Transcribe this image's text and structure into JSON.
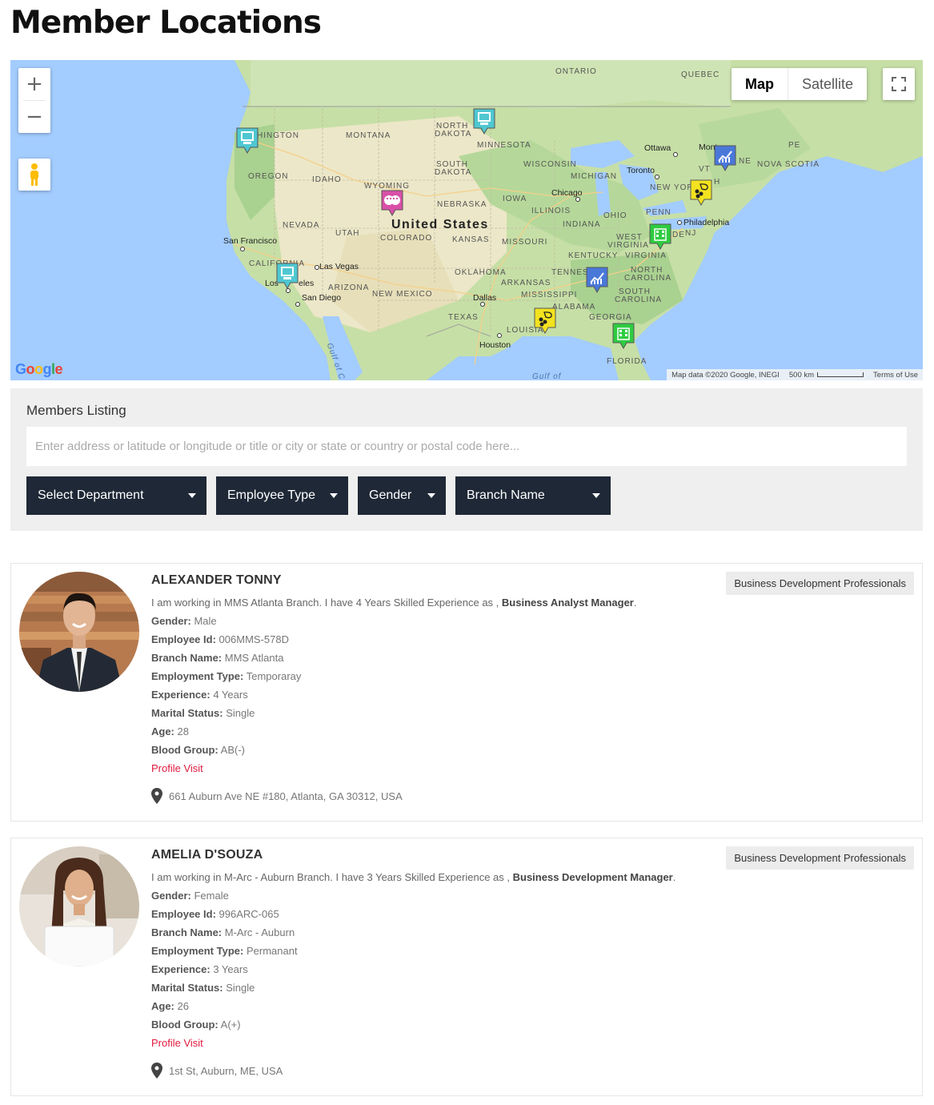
{
  "page_title": "Member Locations",
  "map": {
    "zoom_in": "+",
    "zoom_out": "−",
    "type_map": "Map",
    "type_satellite": "Satellite",
    "google": "Google",
    "attribution": "Map data ©2020 Google, INEGI",
    "scale": "500 km",
    "terms": "Terms of Use",
    "labels": {
      "ontario": "ONTARIO",
      "quebec": "QUEBEC",
      "washington": "HINGTON",
      "montana": "MONTANA",
      "north_dakota_1": "NORTH",
      "north_dakota_2": "DAKOTA",
      "minnesota": "MINNESOTA",
      "oregon": "OREGON",
      "idaho": "IDAHO",
      "south_dakota_1": "SOUTH",
      "south_dakota_2": "DAKOTA",
      "wyoming": "WYOMING",
      "wisconsin": "WISCONSIN",
      "michigan": "MICHIGAN",
      "nevada": "NEVADA",
      "utah": "UTAH",
      "colorado": "COLORADO",
      "nebraska": "NEBRASKA",
      "iowa": "IOWA",
      "illinois": "ILLINOIS",
      "indiana": "INDIANA",
      "ohio": "OHIO",
      "kansas": "KANSAS",
      "missouri": "MISSOURI",
      "california": "CALIFORNIA",
      "arizona": "ARIZONA",
      "new_mexico": "NEW MEXICO",
      "oklahoma": "OKLAHOMA",
      "arkansas": "ARKANSAS",
      "tennessee": "TENNES",
      "kentucky": "KENTUCKY",
      "texas": "TEXAS",
      "louisiana": "LOUISIA",
      "mississippi": "MISSISSIPPI",
      "alabama": "ALABAMA",
      "georgia": "GEORGIA",
      "florida": "FLORIDA",
      "south_carolina_1": "SOUTH",
      "south_carolina_2": "CAROLINA",
      "north_carolina_1": "NORTH",
      "north_carolina_2": "CAROLINA",
      "virginia": "VIRGINIA",
      "west_virginia_1": "WEST",
      "west_virginia_2": "VIRGINIA",
      "penn": "PENN",
      "new_york": "NEW YOR",
      "vt": "VT",
      "nh": "H",
      "ne": "NE",
      "nova_scotia": "NOVA SCOTIA",
      "pe": "PE",
      "nj": "NJ",
      "de": "DE",
      "united_states": "United States",
      "gulf_california": "Gulf of Califo",
      "gulf_of": "Gulf of"
    },
    "cities": {
      "ottawa": "Ottawa",
      "montreal": "Mont",
      "toronto": "Toronto",
      "chicago": "Chicago",
      "philadelphia": "Philadelphia",
      "san_francisco": "San Francisco",
      "las_vegas": "Las Vegas",
      "los_angeles_1": "Los",
      "los_angeles_2": "eles",
      "san_diego": "San Diego",
      "dallas": "Dallas",
      "houston": "Houston"
    },
    "markers": [
      {
        "icon": "computer-icon",
        "color": "#4fc7d1"
      },
      {
        "icon": "computer-icon",
        "color": "#4fc7d1"
      },
      {
        "icon": "computer-icon",
        "color": "#4fc7d1"
      },
      {
        "icon": "theater-masks-icon",
        "color": "#d94fa8"
      },
      {
        "icon": "chart-icon",
        "color": "#4a78d9"
      },
      {
        "icon": "chart-icon",
        "color": "#4a78d9"
      },
      {
        "icon": "team-chat-icon",
        "color": "#f2e21f"
      },
      {
        "icon": "team-chat-icon",
        "color": "#f2e21f"
      },
      {
        "icon": "building-icon",
        "color": "#2ecc40"
      },
      {
        "icon": "building-icon",
        "color": "#2ecc40"
      }
    ]
  },
  "listing": {
    "title": "Members Listing",
    "search_placeholder": "Enter address or latitude or longitude or title or city or state or country or postal code here...",
    "filters": {
      "department": "Select Department",
      "employee_type": "Employee Type",
      "gender": "Gender",
      "branch": "Branch Name"
    }
  },
  "members": [
    {
      "name": "ALEXANDER TONNY",
      "badge": "Business Development Professionals",
      "intro": "I am working in MMS Atlanta Branch. I have 4 Years Skilled Experience as ,",
      "role": "Business Analyst Manager",
      "gender_label": "Gender:",
      "gender": "Male",
      "id_label": "Employee Id:",
      "id": "006MMS-578D",
      "branch_label": "Branch Name:",
      "branch": "MMS Atlanta",
      "type_label": "Employment Type:",
      "type": "Temporaray",
      "exp_label": "Experience:",
      "exp": "4 Years",
      "marital_label": "Marital Status:",
      "marital": "Single",
      "age_label": "Age:",
      "age": "28",
      "blood_label": "Blood Group:",
      "blood": "AB(-)",
      "profile": "Profile Visit",
      "address": "661 Auburn Ave NE #180, Atlanta, GA 30312, USA"
    },
    {
      "name": "AMELIA D'SOUZA",
      "badge": "Business Development Professionals",
      "intro": "I am working in M-Arc - Auburn Branch. I have 3 Years Skilled Experience as ,",
      "role": "Business Development Manager",
      "gender_label": "Gender:",
      "gender": "Female",
      "id_label": "Employee Id:",
      "id": "996ARC-065",
      "branch_label": "Branch Name:",
      "branch": "M-Arc - Auburn",
      "type_label": "Employment Type:",
      "type": "Permanant",
      "exp_label": "Experience:",
      "exp": "3 Years",
      "marital_label": "Marital Status:",
      "marital": "Single",
      "age_label": "Age:",
      "age": "26",
      "blood_label": "Blood Group:",
      "blood": "A(+)",
      "profile": "Profile Visit",
      "address": "1st St, Auburn, ME, USA"
    }
  ]
}
